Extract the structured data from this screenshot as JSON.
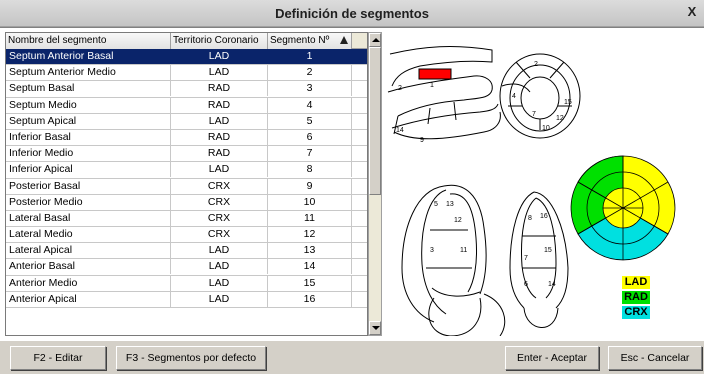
{
  "window": {
    "title": "Definición de segmentos",
    "close_label": "X"
  },
  "table": {
    "headers": [
      "Nombre del segmento",
      "Territorio Coronario",
      "Segmento Nº"
    ],
    "rows": [
      {
        "name": "Septum Anterior Basal",
        "territory": "LAD",
        "segment": "1",
        "selected": true
      },
      {
        "name": "Septum Anterior Medio",
        "territory": "LAD",
        "segment": "2"
      },
      {
        "name": "Septum Basal",
        "territory": "RAD",
        "segment": "3"
      },
      {
        "name": "Septum Medio",
        "territory": "RAD",
        "segment": "4"
      },
      {
        "name": "Septum Apical",
        "territory": "LAD",
        "segment": "5"
      },
      {
        "name": "Inferior Basal",
        "territory": "RAD",
        "segment": "6"
      },
      {
        "name": "Inferior Medio",
        "territory": "RAD",
        "segment": "7"
      },
      {
        "name": "Inferior Apical",
        "territory": "LAD",
        "segment": "8"
      },
      {
        "name": "Posterior Basal",
        "territory": "CRX",
        "segment": "9"
      },
      {
        "name": "Posterior Medio",
        "territory": "CRX",
        "segment": "10"
      },
      {
        "name": "Lateral Basal",
        "territory": "CRX",
        "segment": "11"
      },
      {
        "name": "Lateral Medio",
        "territory": "CRX",
        "segment": "12"
      },
      {
        "name": "Lateral Apical",
        "territory": "LAD",
        "segment": "13"
      },
      {
        "name": "Anterior Basal",
        "territory": "LAD",
        "segment": "14"
      },
      {
        "name": "Anterior Medio",
        "territory": "LAD",
        "segment": "15"
      },
      {
        "name": "Anterior Apical",
        "territory": "LAD",
        "segment": "16"
      }
    ]
  },
  "diagram_labels": {
    "long_axis": [
      "1",
      "2",
      "14",
      "9"
    ],
    "short_axis": [
      "2",
      "4",
      "7",
      "10",
      "12",
      "15"
    ],
    "four_chamber": [
      "5",
      "3",
      "11",
      "12",
      "13"
    ],
    "two_chamber": [
      "8",
      "7",
      "6",
      "16",
      "15",
      "14"
    ]
  },
  "legend": [
    {
      "label": "LAD",
      "color": "#ffff00"
    },
    {
      "label": "RAD",
      "color": "#00e000"
    },
    {
      "label": "CRX",
      "color": "#00e0e0"
    }
  ],
  "colors": {
    "selected_row": "#0a246a",
    "highlight_segment": "#ff0000"
  },
  "buttons": {
    "edit": "F2 - Editar",
    "defaults": "F3 - Segmentos por defecto",
    "accept": "Enter - Aceptar",
    "cancel": "Esc - Cancelar"
  }
}
